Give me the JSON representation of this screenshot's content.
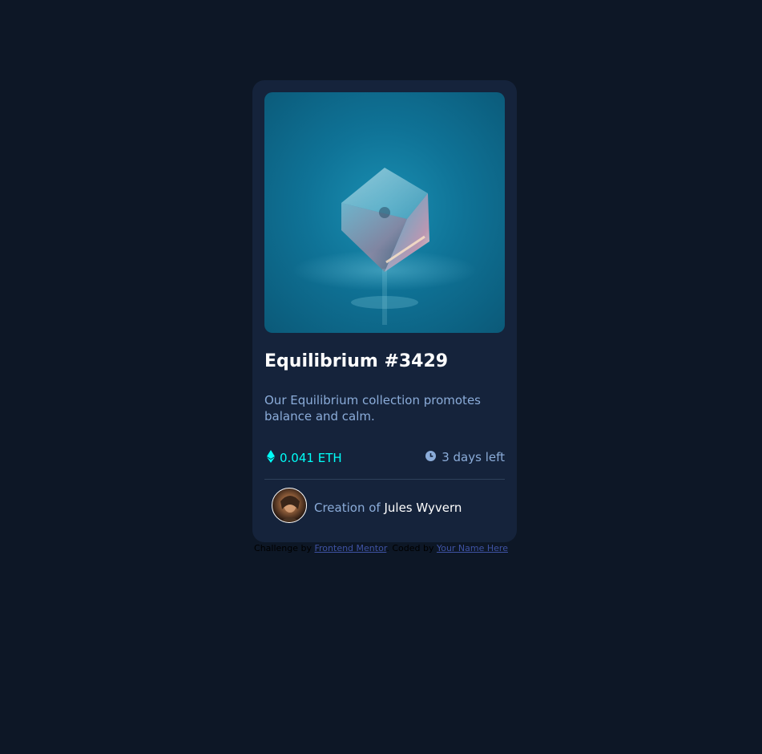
{
  "card": {
    "image_alt": "Equilibrium crystal cube",
    "title": "Equilibrium #3429",
    "description": "Our Equilibrium collection promotes balance and calm.",
    "price": "0.041 ETH",
    "time_left": "3 days left",
    "creator_prefix": "Creation of",
    "creator_name": "Jules Wyvern"
  },
  "attribution": {
    "challenge_prefix": "Challenge by",
    "challenge_link": "Frontend Mentor",
    "coded_prefix": ". Coded by",
    "coded_link": "Your Name Here"
  },
  "icons": {
    "price": "ethereum-icon",
    "time": "clock-icon"
  },
  "colors": {
    "page_background": "#0d1726",
    "card_background": "#15233b",
    "accent_cyan": "#00fff8",
    "soft_blue": "#8bacd9",
    "white": "#ffffff",
    "link": "#3e52a3"
  }
}
